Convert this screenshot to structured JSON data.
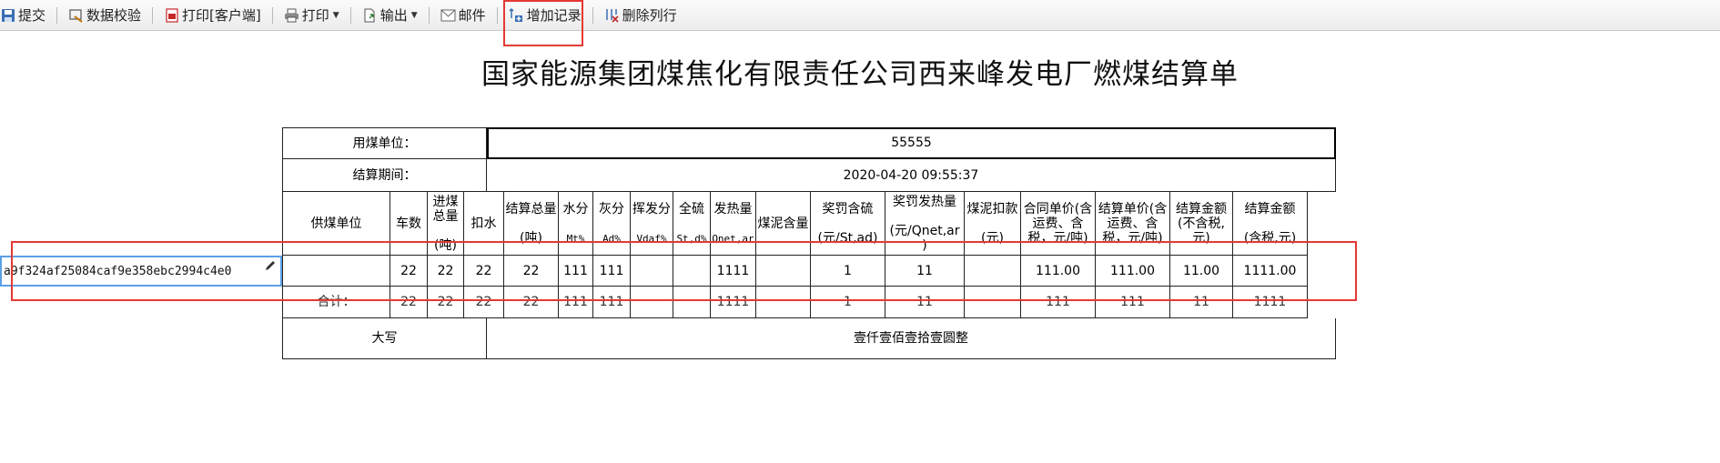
{
  "toolbar": {
    "submit": "提交",
    "validate": "数据校验",
    "print_client": "打印[客户端]",
    "print": "打印",
    "export": "输出",
    "mail": "邮件",
    "add_record": "增加记录",
    "delete_row": "删除列行"
  },
  "title": "国家能源集团煤焦化有限责任公司西来峰发电厂燃煤结算单",
  "info": {
    "unit_label": "用煤单位：",
    "unit_value": "55555",
    "period_label": "结算期间：",
    "period_value": "2020-04-20 09:55:37"
  },
  "headers": [
    {
      "main": "供煤单位",
      "sub": ""
    },
    {
      "main": "车数",
      "sub": ""
    },
    {
      "main": "进煤总量\n\n(吨)",
      "sub": ""
    },
    {
      "main": "扣水",
      "sub": ""
    },
    {
      "main": "结算总量\n\n(吨)",
      "sub": ""
    },
    {
      "main": "水分",
      "sub": "Mt%"
    },
    {
      "main": "灰分",
      "sub": "Ad%"
    },
    {
      "main": "挥发分",
      "sub": "Vdaf%"
    },
    {
      "main": "全硫",
      "sub": "St,d%"
    },
    {
      "main": "发热量",
      "sub": "Qnet,ar"
    },
    {
      "main": "煤泥含量",
      "sub": ""
    },
    {
      "main": "奖罚含硫\n\n(元/St,ad)",
      "sub": ""
    },
    {
      "main": "奖罚发热量\n\n(元/Qnet,ar\n)",
      "sub": ""
    },
    {
      "main": "煤泥扣款\n\n(元)",
      "sub": ""
    },
    {
      "main": "合同单价(含\n运费、含\n税，元/吨)",
      "sub": ""
    },
    {
      "main": "结算单价(含\n运费、含\n税，元/吨)",
      "sub": ""
    },
    {
      "main": "结算金额\n(不含税,\n元)",
      "sub": ""
    },
    {
      "main": "结算金额\n\n(含税,元)",
      "sub": ""
    }
  ],
  "data_row": {
    "supplier_edit_value": "a9f324af25084caf9e358ebc2994c4e0",
    "cells": [
      "22",
      "22",
      "22",
      "22",
      "111",
      "111",
      "",
      "",
      "1111",
      "",
      "1",
      "11",
      "",
      "111.00",
      "111.00",
      "11.00",
      "1111.00"
    ]
  },
  "total_row": {
    "label": "合计：",
    "cells": [
      "22",
      "22",
      "22",
      "22",
      "111",
      "111",
      "",
      "",
      "1111",
      "",
      "1",
      "11",
      "",
      "111",
      "111",
      "11",
      "1111"
    ]
  },
  "uppercase_row": {
    "label": "大写",
    "value": "壹仟壹佰壹拾壹圆整"
  },
  "colors": {
    "highlight": "#e53935",
    "edit_border": "#5aa0e6"
  }
}
